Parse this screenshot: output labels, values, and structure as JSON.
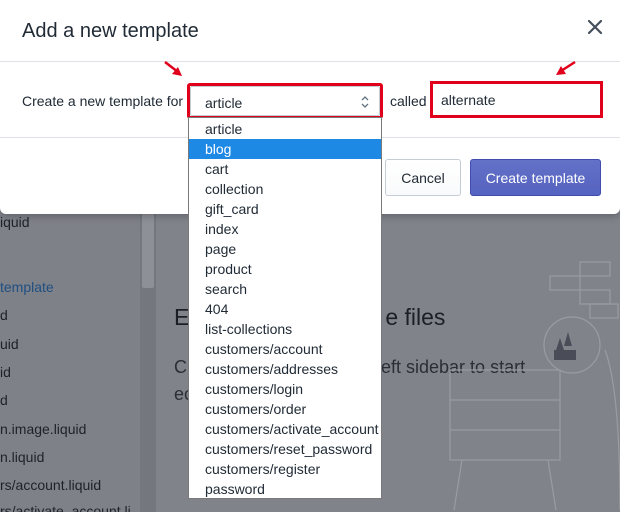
{
  "background": {
    "sidebar_files": [
      {
        "text": "iquid",
        "link": false
      },
      {
        "text": "template",
        "link": true
      },
      {
        "text": "d",
        "link": false
      },
      {
        "text": "uid",
        "link": false
      },
      {
        "text": "id",
        "link": false
      },
      {
        "text": "d",
        "link": false
      },
      {
        "text": "n.image.liquid",
        "link": false
      },
      {
        "text": "n.liquid",
        "link": false
      },
      {
        "text": "rs/account.liquid",
        "link": false
      },
      {
        "text": "rs/activate_account.li",
        "link": false
      }
    ],
    "heading_start": "E",
    "heading_end": "e files",
    "text_line1_start": "C",
    "text_line1_end": "eft sidebar to start",
    "text_line2": "ec"
  },
  "modal": {
    "title": "Add a new template",
    "label_for": "Create a new template for",
    "select_value": "article",
    "label_called": "called",
    "name_value": "alternate",
    "cancel_label": "Cancel",
    "create_label": "Create template"
  },
  "dropdown": {
    "selected_index": 1,
    "options": [
      "article",
      "blog",
      "cart",
      "collection",
      "gift_card",
      "index",
      "page",
      "product",
      "search",
      "404",
      "list-collections",
      "customers/account",
      "customers/addresses",
      "customers/login",
      "customers/order",
      "customers/activate_account",
      "customers/reset_password",
      "customers/register",
      "password"
    ]
  },
  "colors": {
    "primary": "#5c6ac4",
    "highlight_border": "#e0001b",
    "dropdown_selected": "#1e88e5"
  },
  "icons": {
    "close": "close-icon",
    "select_arrows": "chevron-up-down-icon",
    "annotation": "red-arrow-icon"
  }
}
